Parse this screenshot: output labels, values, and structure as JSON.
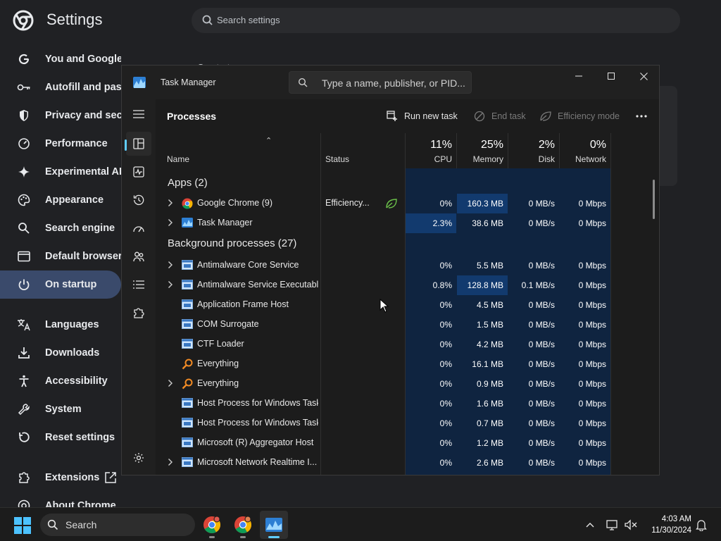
{
  "settings": {
    "title": "Settings",
    "search_placeholder": "Search settings",
    "nav": [
      {
        "label": "You and Google",
        "icon": "google-icon"
      },
      {
        "label": "Autofill and passwords",
        "icon": "key-icon"
      },
      {
        "label": "Privacy and security",
        "icon": "shield-icon"
      },
      {
        "label": "Performance",
        "icon": "speedometer-icon"
      },
      {
        "label": "Experimental AI",
        "icon": "sparkle-icon"
      },
      {
        "label": "Appearance",
        "icon": "palette-icon"
      },
      {
        "label": "Search engine",
        "icon": "search-icon"
      },
      {
        "label": "Default browser",
        "icon": "browser-icon"
      },
      {
        "label": "On startup",
        "icon": "power-icon"
      },
      {
        "label": "Languages",
        "icon": "translate-icon"
      },
      {
        "label": "Downloads",
        "icon": "download-icon"
      },
      {
        "label": "Accessibility",
        "icon": "accessibility-icon"
      },
      {
        "label": "System",
        "icon": "wrench-icon"
      },
      {
        "label": "Reset settings",
        "icon": "reset-icon"
      },
      {
        "label": "Extensions",
        "icon": "puzzle-icon"
      },
      {
        "label": "About Chrome",
        "icon": "chrome-icon"
      }
    ],
    "active_nav": "On startup",
    "peek_text": "On startup"
  },
  "task_manager": {
    "title": "Task Manager",
    "search_placeholder": "Type a name, publisher, or PID...",
    "page_title": "Processes",
    "toolbar": {
      "run_new_task": "Run new task",
      "end_task": "End task",
      "efficiency_mode": "Efficiency mode",
      "more": "..."
    },
    "columns": {
      "name": "Name",
      "status": "Status",
      "cpu_pct": "11%",
      "cpu": "CPU",
      "memory_pct": "25%",
      "memory": "Memory",
      "disk_pct": "2%",
      "disk": "Disk",
      "network_pct": "0%",
      "network": "Network"
    },
    "groups": {
      "apps": "Apps (2)",
      "background": "Background processes (27)"
    },
    "apps": [
      {
        "name": "Google Chrome (9)",
        "status": "Efficiency...",
        "cpu": "0%",
        "memory": "160.3 MB",
        "disk": "0 MB/s",
        "network": "0 Mbps",
        "icon": "chrome-icon",
        "expandable": true
      },
      {
        "name": "Task Manager",
        "status": "",
        "cpu": "2.3%",
        "memory": "38.6 MB",
        "disk": "0 MB/s",
        "network": "0 Mbps",
        "icon": "task-manager-icon",
        "expandable": true
      }
    ],
    "background": [
      {
        "name": "Antimalware Core Service",
        "cpu": "0%",
        "memory": "5.5 MB",
        "disk": "0 MB/s",
        "network": "0 Mbps",
        "icon": "window-app-icon",
        "expandable": true
      },
      {
        "name": "Antimalware Service Executable",
        "cpu": "0.8%",
        "memory": "128.8 MB",
        "disk": "0.1 MB/s",
        "network": "0 Mbps",
        "icon": "window-app-icon",
        "expandable": true
      },
      {
        "name": "Application Frame Host",
        "cpu": "0%",
        "memory": "4.5 MB",
        "disk": "0 MB/s",
        "network": "0 Mbps",
        "icon": "window-app-icon",
        "expandable": false
      },
      {
        "name": "COM Surrogate",
        "cpu": "0%",
        "memory": "1.5 MB",
        "disk": "0 MB/s",
        "network": "0 Mbps",
        "icon": "window-app-icon",
        "expandable": false
      },
      {
        "name": "CTF Loader",
        "cpu": "0%",
        "memory": "4.2 MB",
        "disk": "0 MB/s",
        "network": "0 Mbps",
        "icon": "window-app-icon",
        "expandable": false
      },
      {
        "name": "Everything",
        "cpu": "0%",
        "memory": "16.1 MB",
        "disk": "0 MB/s",
        "network": "0 Mbps",
        "icon": "magnifier-app-icon",
        "expandable": false
      },
      {
        "name": "Everything",
        "cpu": "0%",
        "memory": "0.9 MB",
        "disk": "0 MB/s",
        "network": "0 Mbps",
        "icon": "magnifier-app-icon",
        "expandable": true
      },
      {
        "name": "Host Process for Windows Tasks",
        "cpu": "0%",
        "memory": "1.6 MB",
        "disk": "0 MB/s",
        "network": "0 Mbps",
        "icon": "window-app-icon",
        "expandable": false
      },
      {
        "name": "Host Process for Windows Tasks",
        "cpu": "0%",
        "memory": "0.7 MB",
        "disk": "0 MB/s",
        "network": "0 Mbps",
        "icon": "window-app-icon",
        "expandable": false
      },
      {
        "name": "Microsoft (R) Aggregator Host",
        "cpu": "0%",
        "memory": "1.2 MB",
        "disk": "0 MB/s",
        "network": "0 Mbps",
        "icon": "window-app-icon",
        "expandable": false
      },
      {
        "name": "Microsoft Network Realtime I...",
        "cpu": "0%",
        "memory": "2.6 MB",
        "disk": "0 MB/s",
        "network": "0 Mbps",
        "icon": "window-app-icon",
        "expandable": true
      }
    ]
  },
  "taskbar": {
    "search_label": "Search",
    "time": "4:03 AM",
    "date": "11/30/2024"
  },
  "colors": {
    "accent": "#60cdff",
    "heat_low": "#0f2b4d",
    "heat_mid": "#123a6e",
    "heat_high": "#1a4b8a",
    "settings_active": "#3a4a6b"
  }
}
